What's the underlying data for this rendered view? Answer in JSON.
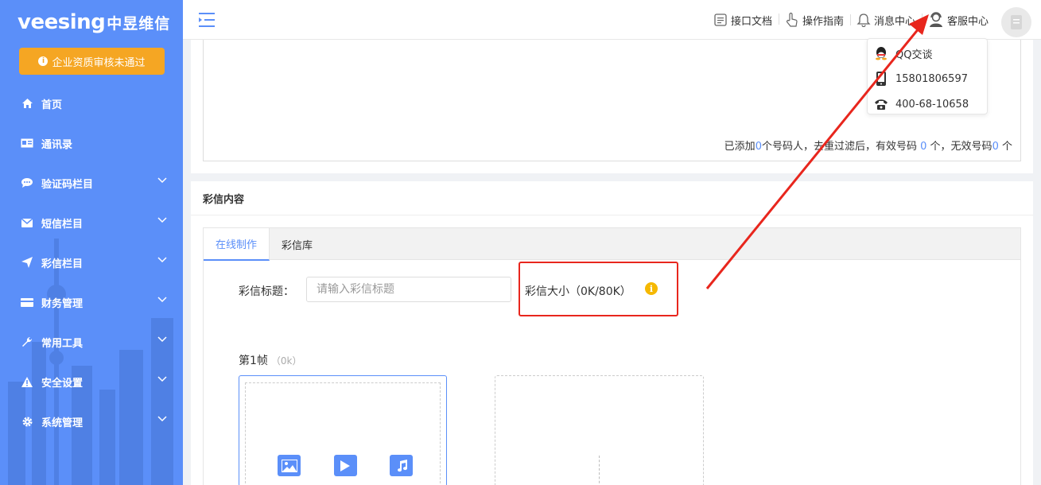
{
  "brand": {
    "logo_en": "veesing",
    "logo_cn": "中昱维信"
  },
  "sidebar": {
    "alert_label": "企业资质审核未通过",
    "items": [
      {
        "label": "首页",
        "icon": "home-icon",
        "has_chevron": false
      },
      {
        "label": "通讯录",
        "icon": "contacts-icon",
        "has_chevron": false
      },
      {
        "label": "验证码栏目",
        "icon": "chat-bubble-icon",
        "has_chevron": true
      },
      {
        "label": "短信栏目",
        "icon": "envelope-icon",
        "has_chevron": true
      },
      {
        "label": "彩信栏目",
        "icon": "paper-plane-icon",
        "has_chevron": true
      },
      {
        "label": "财务管理",
        "icon": "credit-card-icon",
        "has_chevron": true
      },
      {
        "label": "常用工具",
        "icon": "wrench-icon",
        "has_chevron": true
      },
      {
        "label": "安全设置",
        "icon": "warning-icon",
        "has_chevron": true
      },
      {
        "label": "系统管理",
        "icon": "gear-icon",
        "has_chevron": true
      }
    ]
  },
  "topbar": {
    "links": [
      {
        "label": "接口文档",
        "icon": "document-icon"
      },
      {
        "label": "操作指南",
        "icon": "pointer-hand-icon"
      },
      {
        "label": "消息中心",
        "icon": "bell-icon"
      },
      {
        "label": "客服中心",
        "icon": "customer-service-icon"
      }
    ]
  },
  "cs_dropdown": {
    "items": [
      {
        "label": "QQ交谈",
        "icon": "qq-icon"
      },
      {
        "label": "15801806597",
        "icon": "mobile-phone-icon"
      },
      {
        "label": "400-68-10658",
        "icon": "telephone-icon"
      }
    ]
  },
  "numbers": {
    "prefix": "已添加",
    "added": "0",
    "mid1": "个号码人，去重过滤后，有效号码",
    "valid": "0",
    "mid2": "个，无效号码",
    "invalid": "0",
    "suffix": "个"
  },
  "mms": {
    "section_title": "彩信内容",
    "tabs": [
      {
        "label": "在线制作",
        "active": true
      },
      {
        "label": "彩信库",
        "active": false
      }
    ],
    "title_label": "彩信标题：",
    "title_placeholder": "请输入彩信标题",
    "title_value": "",
    "size_label": "彩信大小（0K/80K）",
    "frame_label": "第1帧",
    "frame_size": "（0k）"
  },
  "colors": {
    "sidebar": "#5b8ff9",
    "alert": "#f5a623",
    "accent": "#5b8ff9",
    "annotation": "#e8261d",
    "info": "#f5b800"
  }
}
